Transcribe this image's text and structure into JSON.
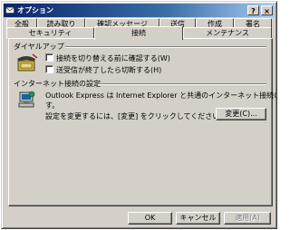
{
  "window": {
    "title": "オプション",
    "close_label": "×",
    "help_label": "?"
  },
  "tabs_row1": [
    "全般",
    "読み取り",
    "確認メッセージ",
    "送信",
    "作成",
    "署名"
  ],
  "tabs_row2": [
    "セキュリティ",
    "接続",
    "メンテナンス"
  ],
  "selected_tab": "接続",
  "dialup": {
    "title": "ダイヤルアップ",
    "options": [
      {
        "label": "接続を切り替える前に確認する(W)",
        "checked": false
      },
      {
        "label": "送受信が終了したら切断する(H)",
        "checked": false
      }
    ]
  },
  "internet": {
    "title": "インターネット接続の設定",
    "description_line1": "Outlook Express は Internet Explorer と共通のインターネット接続の設定を使用しま",
    "description_line2": "す。",
    "change_hint": "設定を変更するには、[変更] をクリックしてください。",
    "change_button": "変更(C)..."
  },
  "footer": {
    "ok": "OK",
    "cancel": "キャンセル",
    "apply": "適用(A)"
  },
  "colors": {
    "titlebar_start": "#0a246a",
    "titlebar_end": "#a6caf0",
    "face": "#d4d0c8"
  }
}
